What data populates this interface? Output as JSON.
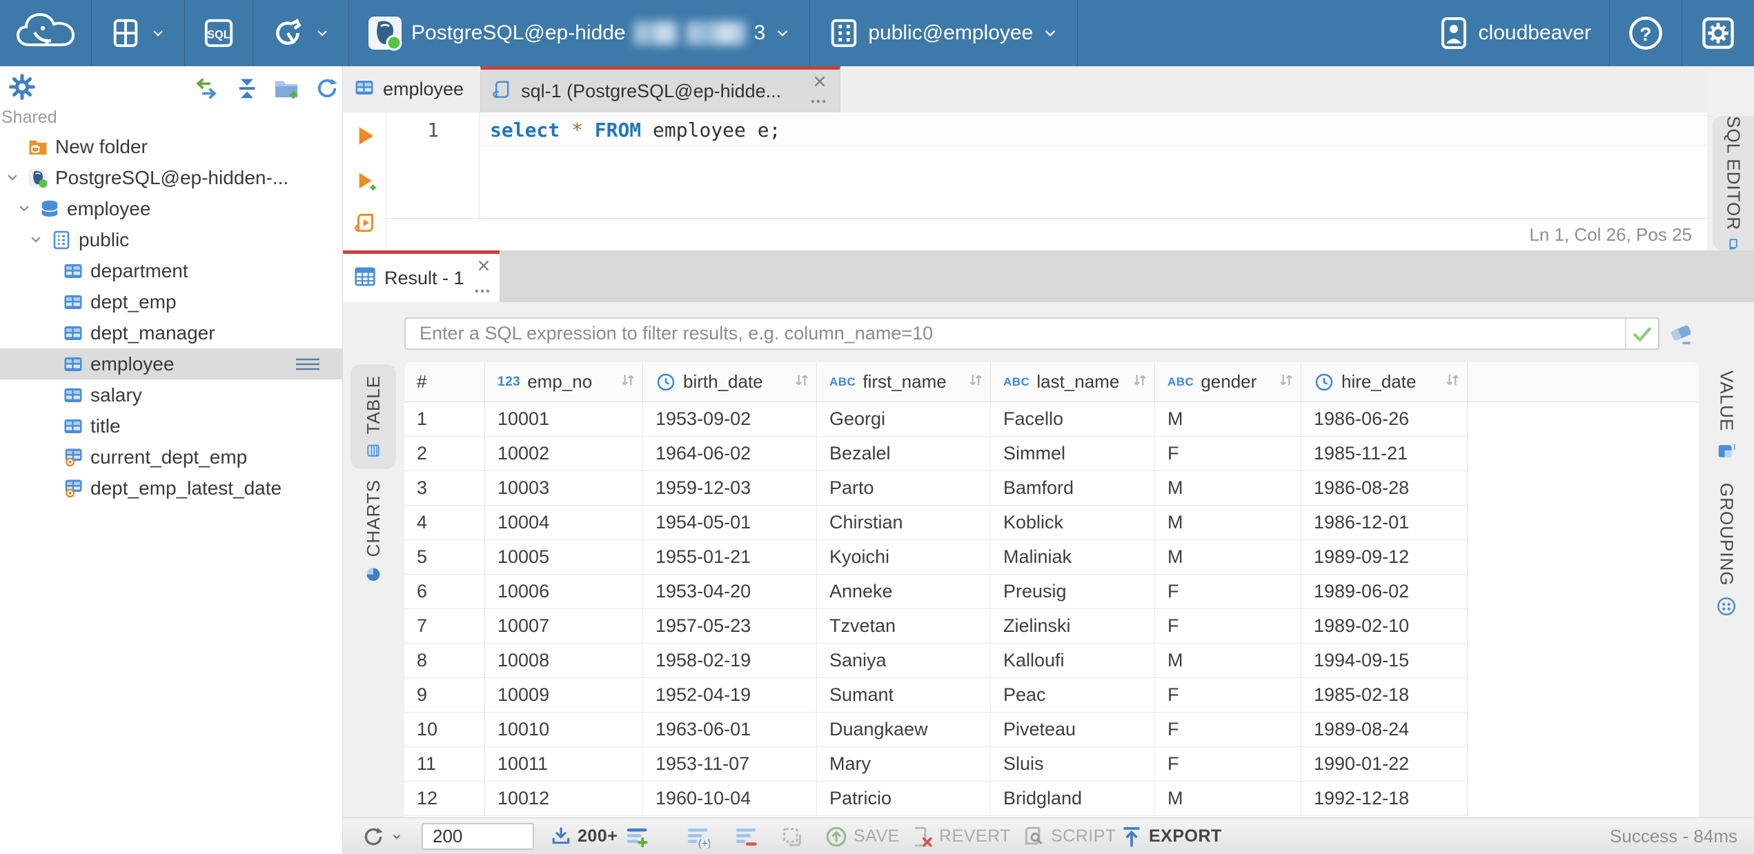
{
  "colors": {
    "topbar_blue": "#3d79a9",
    "accent_red": "#c5423e",
    "icon_blue": "#4a8ed9",
    "keyword_blue": "#2277b8",
    "exec_orange": "#ef8b1f",
    "check_green": "#8fc97f"
  },
  "topbar": {
    "sql_badge": "SQL",
    "connection": {
      "label": "PostgreSQL@ep-hidde",
      "redacted": true,
      "suffix": "3"
    },
    "schema_label": "public@employee",
    "user_name": "cloudbeaver"
  },
  "sidebar": {
    "shared_label": "Shared",
    "tree": [
      {
        "label": "New folder",
        "icon": "folder-db",
        "level": 0,
        "chevron": false,
        "selected": false,
        "menu": false
      },
      {
        "label": "PostgreSQL@ep-hidden-...",
        "icon": "postgres",
        "level": 0,
        "chevron": true,
        "selected": false,
        "menu": false
      },
      {
        "label": "employee",
        "icon": "database",
        "level": 1,
        "chevron": true,
        "selected": false,
        "menu": false
      },
      {
        "label": "public",
        "icon": "schema",
        "level": 2,
        "chevron": true,
        "selected": false,
        "menu": false
      },
      {
        "label": "department",
        "icon": "table",
        "level": 3,
        "chevron": false,
        "selected": false,
        "menu": false
      },
      {
        "label": "dept_emp",
        "icon": "table",
        "level": 3,
        "chevron": false,
        "selected": false,
        "menu": false
      },
      {
        "label": "dept_manager",
        "icon": "table",
        "level": 3,
        "chevron": false,
        "selected": false,
        "menu": false
      },
      {
        "label": "employee",
        "icon": "table",
        "level": 3,
        "chevron": false,
        "selected": true,
        "menu": true
      },
      {
        "label": "salary",
        "icon": "table",
        "level": 3,
        "chevron": false,
        "selected": false,
        "menu": false
      },
      {
        "label": "title",
        "icon": "table",
        "level": 3,
        "chevron": false,
        "selected": false,
        "menu": false
      },
      {
        "label": "current_dept_emp",
        "icon": "view",
        "level": 3,
        "chevron": false,
        "selected": false,
        "menu": false
      },
      {
        "label": "dept_emp_latest_date",
        "icon": "view",
        "level": 3,
        "chevron": false,
        "selected": false,
        "menu": false
      }
    ]
  },
  "editor": {
    "tabs": [
      {
        "label": "employee",
        "icon": "table",
        "active": false
      },
      {
        "label": "sql-1 (PostgreSQL@ep-hidde...",
        "icon": "script",
        "active": true
      }
    ],
    "line_number": "1",
    "code_tokens": [
      {
        "text": "select",
        "type": "keyword"
      },
      {
        "text": " ",
        "type": "plain"
      },
      {
        "text": "*",
        "type": "star"
      },
      {
        "text": " ",
        "type": "plain"
      },
      {
        "text": "FROM",
        "type": "keyword"
      },
      {
        "text": " employee e;",
        "type": "plain"
      }
    ],
    "status": "Ln 1, Col 26, Pos 25",
    "vertical_tab_label": "SQL EDITOR"
  },
  "result": {
    "tab_label": "Result - 1",
    "filter_placeholder": "Enter a SQL expression to filter results, e.g. column_name=10",
    "left_tabs": [
      "TABLE",
      "CHARTS"
    ],
    "right_tabs": [
      "VALUE",
      "GROUPING"
    ],
    "grid": {
      "columns": [
        {
          "label": "#",
          "type": "rownum"
        },
        {
          "label": "emp_no",
          "type": "number"
        },
        {
          "label": "birth_date",
          "type": "date"
        },
        {
          "label": "first_name",
          "type": "string"
        },
        {
          "label": "last_name",
          "type": "string"
        },
        {
          "label": "gender",
          "type": "string"
        },
        {
          "label": "hire_date",
          "type": "date"
        }
      ],
      "rows": [
        [
          "1",
          "10001",
          "1953-09-02",
          "Georgi",
          "Facello",
          "M",
          "1986-06-26"
        ],
        [
          "2",
          "10002",
          "1964-06-02",
          "Bezalel",
          "Simmel",
          "F",
          "1985-11-21"
        ],
        [
          "3",
          "10003",
          "1959-12-03",
          "Parto",
          "Bamford",
          "M",
          "1986-08-28"
        ],
        [
          "4",
          "10004",
          "1954-05-01",
          "Chirstian",
          "Koblick",
          "M",
          "1986-12-01"
        ],
        [
          "5",
          "10005",
          "1955-01-21",
          "Kyoichi",
          "Maliniak",
          "M",
          "1989-09-12"
        ],
        [
          "6",
          "10006",
          "1953-04-20",
          "Anneke",
          "Preusig",
          "F",
          "1989-06-02"
        ],
        [
          "7",
          "10007",
          "1957-05-23",
          "Tzvetan",
          "Zielinski",
          "F",
          "1989-02-10"
        ],
        [
          "8",
          "10008",
          "1958-02-19",
          "Saniya",
          "Kalloufi",
          "M",
          "1994-09-15"
        ],
        [
          "9",
          "10009",
          "1952-04-19",
          "Sumant",
          "Peac",
          "F",
          "1985-02-18"
        ],
        [
          "10",
          "10010",
          "1963-06-01",
          "Duangkaew",
          "Piveteau",
          "F",
          "1989-08-24"
        ],
        [
          "11",
          "10011",
          "1953-11-07",
          "Mary",
          "Sluis",
          "F",
          "1990-01-22"
        ],
        [
          "12",
          "10012",
          "1960-10-04",
          "Patricio",
          "Bridgland",
          "M",
          "1992-12-18"
        ]
      ]
    }
  },
  "toolbar": {
    "row_limit": "200",
    "fetch_label": "200+",
    "save_label": "SAVE",
    "revert_label": "REVERT",
    "script_label": "SCRIPT",
    "export_label": "EXPORT",
    "status": "Success - 84ms"
  }
}
